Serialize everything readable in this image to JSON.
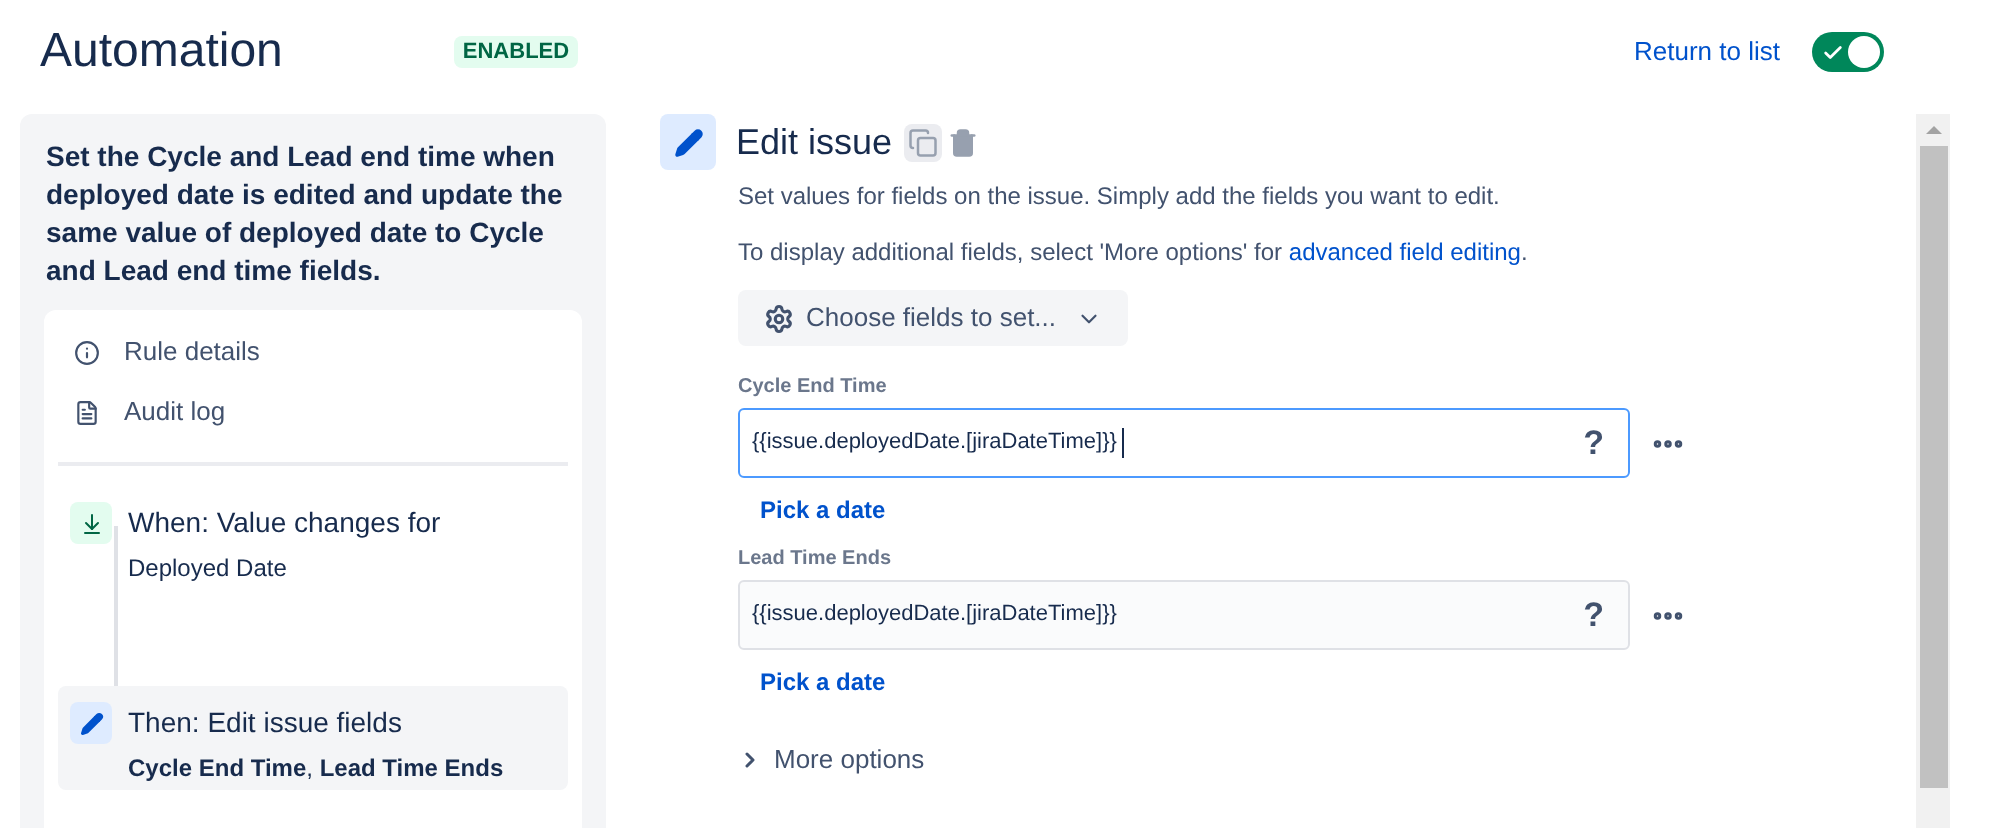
{
  "header": {
    "title": "Automation",
    "status": "ENABLED",
    "return_link": "Return to list",
    "toggle": {
      "on": true
    }
  },
  "rule": {
    "description": "Set the Cycle and Lead end time when deployed date is edited and update the same value of deployed date to Cycle and Lead end time fields.",
    "menu": [
      {
        "kind": "info",
        "label": "Rule details"
      },
      {
        "kind": "log",
        "label": "Audit log"
      }
    ],
    "steps": [
      {
        "kind": "trigger",
        "title": "When: Value changes for",
        "detail": "Deployed Date",
        "selected": false
      },
      {
        "kind": "action",
        "title": "Then: Edit issue fields",
        "detail": "**Cycle End Time**, **Lead Time Ends**",
        "selected": true
      }
    ]
  },
  "editor": {
    "title": "Edit issue",
    "description": "Set values for fields on the issue. Simply add the fields you want to edit.",
    "note": "To display additional fields, select 'More options' for ",
    "note_link": "advanced field editing",
    "note_end": ".",
    "choose_button": "Choose fields to set...",
    "fields": [
      {
        "label": "Cycle End Time",
        "value": "{{issue.deployedDate.[jiraDateTime]}}",
        "help": "?",
        "focused": true,
        "link": "Pick a date"
      },
      {
        "label": "Lead Time Ends",
        "value": "{{issue.deployedDate.[jiraDateTime]}}",
        "help": "?",
        "focused": false,
        "link": "Pick a date"
      }
    ],
    "more_options": {
      "label": "More options",
      "expanded": false
    }
  }
}
